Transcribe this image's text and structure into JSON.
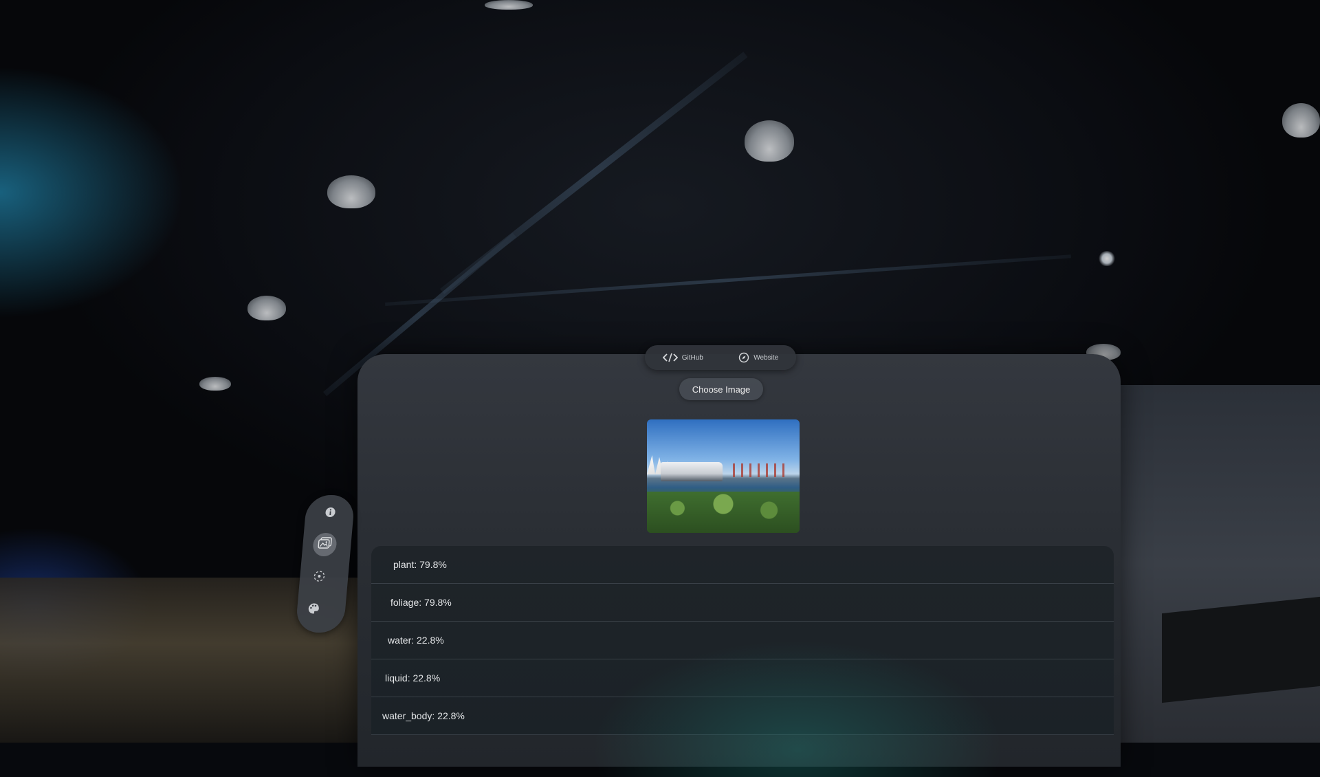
{
  "ornament": {
    "github_label": "GitHub",
    "website_label": "Website"
  },
  "main": {
    "choose_image_label": "Choose Image",
    "results": [
      {
        "label": "plant: 79.8%"
      },
      {
        "label": "foliage: 79.8%"
      },
      {
        "label": "water: 22.8%"
      },
      {
        "label": "liquid: 22.8%"
      },
      {
        "label": "water_body: 22.8%"
      }
    ]
  },
  "tabbar": {
    "tabs": [
      {
        "icon": "info-icon",
        "active": false
      },
      {
        "icon": "photo-icon",
        "active": true
      },
      {
        "icon": "detection-icon",
        "active": false
      },
      {
        "icon": "palette-icon",
        "active": false
      }
    ]
  }
}
